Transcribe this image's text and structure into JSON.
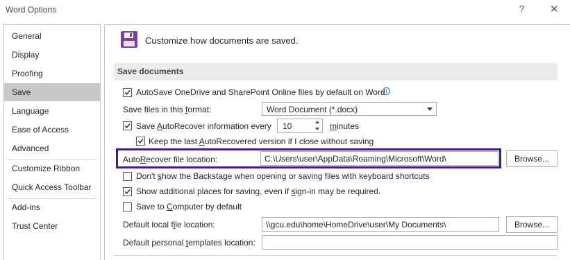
{
  "window": {
    "title": "Word Options",
    "help_glyph": "?",
    "close_glyph": "✕"
  },
  "sidebar": {
    "items": [
      {
        "label": "General"
      },
      {
        "label": "Display"
      },
      {
        "label": "Proofing"
      },
      {
        "label": "Save",
        "active": true
      },
      {
        "label": "Language"
      },
      {
        "label": "Ease of Access"
      },
      {
        "label": "Advanced"
      },
      {
        "label": "Customize Ribbon"
      },
      {
        "label": "Quick Access Toolbar"
      },
      {
        "label": "Add-ins"
      },
      {
        "label": "Trust Center"
      }
    ]
  },
  "main": {
    "heading": "Customize how documents are saved.",
    "section_title": "Save documents",
    "autosave": {
      "checked": true,
      "label": "AutoSave OneDrive and SharePoint Online files by default on Word",
      "icon": "info-icon"
    },
    "format": {
      "label_pre": "Save files in this ",
      "label_u": "f",
      "label_post": "ormat:",
      "value": "Word Document (*.docx)"
    },
    "autorecover": {
      "checked": true,
      "label_pre": "Save ",
      "label_u": "A",
      "label_post": "utoRecover information every",
      "value": "10",
      "unit_u": "m",
      "unit_post": "inutes"
    },
    "keep_last": {
      "checked": true,
      "label_pre": "Keep the last ",
      "label_u": "A",
      "label_post": "utoRecovered version if I close without saving"
    },
    "location": {
      "label_pre": "Auto",
      "label_u": "R",
      "label_post": "ecover file location:",
      "value": "C:\\Users\\user\\AppData\\Roaming\\Microsoft\\Word\\",
      "browse": "Browse...",
      "highlight_color": "#3d1f86"
    },
    "backstage": {
      "checked": false,
      "label_pre": "Don't ",
      "label_u": "s",
      "label_post": "how the Backstage when opening or saving files with keyboard shortcuts"
    },
    "additional_places": {
      "checked": true,
      "label_pre": "Show additional places for saving, even if ",
      "label_u": "s",
      "label_post": "ign-in may be required."
    },
    "save_to_computer": {
      "checked": false,
      "label_pre": "Save to ",
      "label_u": "C",
      "label_post": "omputer by default"
    },
    "local_location": {
      "label_pre": "Default local f",
      "label_u": "i",
      "label_post": "le location:",
      "value": "\\\\gcu.edu\\home\\HomeDrive\\user\\My Documents\\",
      "browse": "Browse..."
    },
    "templates": {
      "label_pre": "Default personal ",
      "label_u": "t",
      "label_post": "emplates location:",
      "value": ""
    }
  },
  "colors": {
    "accent_purple": "#7b3f9e",
    "selected_nav": "#c8c8c8",
    "section_bar": "#ebebeb"
  }
}
